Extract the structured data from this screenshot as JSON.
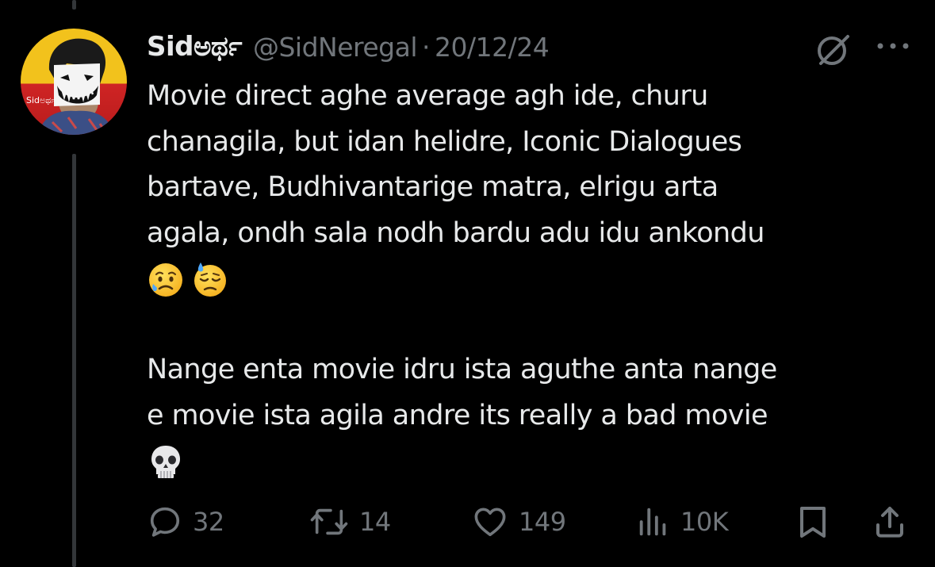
{
  "tweet": {
    "author": {
      "display_name": "Sidಅರ್ಥ",
      "handle": "@SidNeregal",
      "avatar_badge_text": "Sidಅರ್ಥ"
    },
    "separator": "·",
    "date": "20/12/24",
    "body": {
      "paragraph1_lines": [
        "Movie direct aghe average agh ide, churu",
        "chanagila, but idan helidre, Iconic Dialogues",
        "bartave, Budhivantarige matra, elrigu arta",
        "agala, ondh sala nodh bardu adu idu ankondu"
      ],
      "paragraph1_emojis": [
        "sad-but-relieved-face-emoji",
        "downcast-face-with-sweat-emoji"
      ],
      "paragraph2_lines": [
        "Nange enta movie idru ista aguthe anta nange",
        "e movie ista agila andre its really a bad movie"
      ],
      "paragraph2_emojis": [
        "skull-emoji"
      ]
    },
    "actions": {
      "replies": "32",
      "reposts": "14",
      "likes": "149",
      "views": "10K"
    }
  },
  "colors": {
    "background": "#000000",
    "text_primary": "#e7e9ea",
    "text_secondary": "#71767b",
    "thread_line": "#333639"
  },
  "icons": [
    "no-reply-icon",
    "more-icon",
    "reply-icon",
    "repost-icon",
    "like-icon",
    "views-icon",
    "bookmark-icon",
    "share-icon"
  ]
}
